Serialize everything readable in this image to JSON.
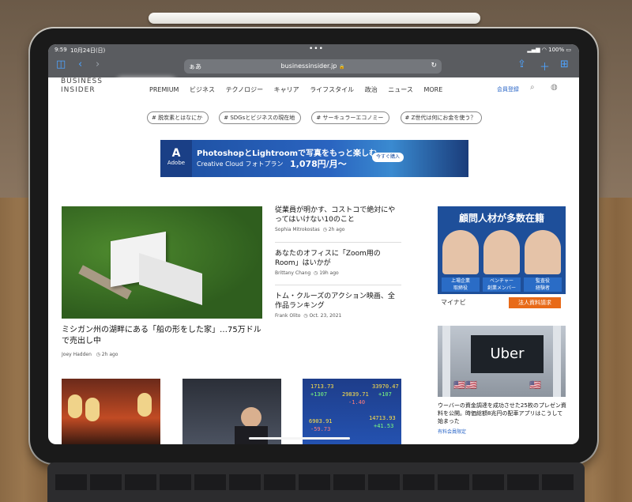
{
  "status": {
    "time": "9:59",
    "date": "10月24日(日)",
    "battery": "100%"
  },
  "browser": {
    "address_prefix": "ぁあ",
    "url": "businessinsider.jp",
    "lock": "🔒"
  },
  "site": {
    "logo_line1": "BUSINESS",
    "logo_line2": "INSIDER",
    "nav": [
      "PREMIUM",
      "ビジネス",
      "テクノロジー",
      "キャリア",
      "ライフスタイル",
      "政治",
      "ニュース",
      "MORE"
    ],
    "member": "会員登録",
    "topics": [
      "脱炭素とはなにか",
      "SDGsとビジネスの現在地",
      "サーキュラーエコノミー",
      "Z世代は何にお金を使う？"
    ]
  },
  "ad_banner": {
    "brand": "Adobe",
    "line1": "PhotoshopとLightroomで写真をもっと楽しむ",
    "line2": "Creative Cloud フォトプラン",
    "price": "1,078円/月～",
    "cta": "今すぐ購入"
  },
  "main_article": {
    "title": "ミシガン州の湖畔にある「船の形をした家」…75万ドルで売出し中",
    "author": "Joey Hadden",
    "time": "2h ago"
  },
  "side_articles": [
    {
      "title": "従業員が明かす、コストコで絶対にやってはいけない10のこと",
      "author": "Sophia Mitrokostas",
      "time": "2h ago"
    },
    {
      "title": "あなたのオフィスに「Zoom用のRoom」はいかが",
      "author": "Brittany Chang",
      "time": "19h ago"
    },
    {
      "title": "トム・クルーズのアクション映画、全作品ランキング",
      "author": "Frank Olito",
      "time": "Oct. 23, 2021"
    }
  ],
  "right_ad": {
    "headline": "顧問人材が多数在籍",
    "labels": [
      "上場企業\n取締役",
      "ベンチャー\n創業メンバー",
      "監査役\n経験者"
    ],
    "brand": "マイナビ",
    "cta": "法人資料請求"
  },
  "uber_article": {
    "sign": "Uber",
    "title": "ウーバーの資金調達を成功させた25枚のプレゼン資料を公開。時価総額8兆円の配車アプリはこうして始まった",
    "tag": "有料会員限定"
  },
  "tickers": [
    "1713.73",
    "+1307",
    "29839.71",
    "-1.40",
    "33970.47",
    "+107",
    "6903.91",
    "-59.73",
    "14713.93",
    "+41.53"
  ]
}
